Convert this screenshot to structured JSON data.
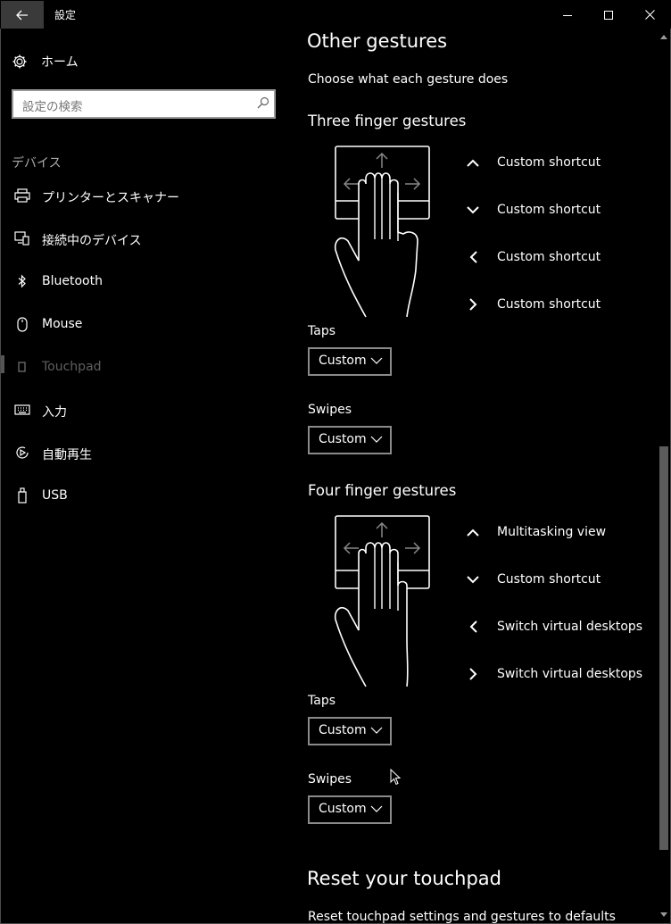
{
  "window": {
    "title": "設定",
    "back_icon": "back-arrow-icon",
    "minimize_icon": "minimize-icon",
    "maximize_icon": "maximize-icon",
    "close_icon": "close-icon"
  },
  "sidebar": {
    "home_label": "ホーム",
    "search_placeholder": "設定の検索",
    "section_header": "デバイス",
    "items": [
      {
        "label": "プリンターとスキャナー",
        "icon": "printer-icon"
      },
      {
        "label": "接続中のデバイス",
        "icon": "connected-devices-icon"
      },
      {
        "label": "Bluetooth",
        "icon": "bluetooth-icon"
      },
      {
        "label": "Mouse",
        "icon": "mouse-icon"
      },
      {
        "label": "Touchpad",
        "icon": "touchpad-icon",
        "selected": true
      },
      {
        "label": "入力",
        "icon": "keyboard-icon"
      },
      {
        "label": "自動再生",
        "icon": "autoplay-icon"
      },
      {
        "label": "USB",
        "icon": "usb-icon"
      }
    ]
  },
  "content": {
    "title": "Other gestures",
    "subtitle": "Choose what each gesture does",
    "three_finger": {
      "heading": "Three finger gestures",
      "up": "Custom shortcut",
      "down": "Custom shortcut",
      "left": "Custom shortcut",
      "right": "Custom shortcut",
      "taps_label": "Taps",
      "taps_value": "Custom",
      "swipes_label": "Swipes",
      "swipes_value": "Custom"
    },
    "four_finger": {
      "heading": "Four finger gestures",
      "up": "Multitasking view",
      "down": "Custom shortcut",
      "left": "Switch virtual desktops",
      "right": "Switch virtual desktops",
      "taps_label": "Taps",
      "taps_value": "Custom",
      "swipes_label": "Swipes",
      "swipes_value": "Custom"
    },
    "reset": {
      "heading": "Reset your touchpad",
      "description": "Reset touchpad settings and gestures to defaults"
    }
  }
}
